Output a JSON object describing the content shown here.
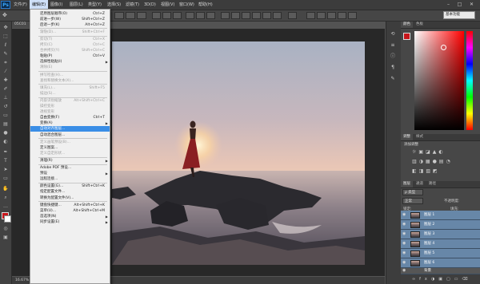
{
  "app": {
    "logo": "Ps"
  },
  "menubar": {
    "items": [
      "文件(F)",
      "编辑(E)",
      "图像(I)",
      "图层(L)",
      "类型(Y)",
      "选择(S)",
      "滤镜(T)",
      "3D(D)",
      "视图(V)",
      "窗口(W)",
      "帮助(H)"
    ],
    "active_index": 1
  },
  "options": {
    "workspace": "基本功能"
  },
  "document": {
    "tab": "05C01",
    "zoom": "16.67%"
  },
  "edit_menu": {
    "items": [
      {
        "label": "还原图层顺序(O)",
        "shortcut": "Ctrl+Z",
        "disabled": false
      },
      {
        "label": "前进一步(W)",
        "shortcut": "Shift+Ctrl+Z",
        "disabled": false
      },
      {
        "label": "后退一步(K)",
        "shortcut": "Alt+Ctrl+Z",
        "disabled": false
      },
      {
        "sep": true
      },
      {
        "label": "渐隐(D)...",
        "shortcut": "Shift+Ctrl+F",
        "disabled": true
      },
      {
        "sep": true
      },
      {
        "label": "剪切(T)",
        "shortcut": "Ctrl+X",
        "disabled": true
      },
      {
        "label": "拷贝(C)",
        "shortcut": "Ctrl+C",
        "disabled": true
      },
      {
        "label": "合并拷贝(Y)",
        "shortcut": "Shift+Ctrl+C",
        "disabled": true
      },
      {
        "label": "粘贴(P)",
        "shortcut": "Ctrl+V",
        "disabled": false
      },
      {
        "label": "选择性粘贴(I)",
        "shortcut": "",
        "disabled": false,
        "submenu": true
      },
      {
        "label": "清除(E)",
        "shortcut": "",
        "disabled": true
      },
      {
        "sep": true
      },
      {
        "label": "拼写检查(H)...",
        "shortcut": "",
        "disabled": true
      },
      {
        "label": "查找和替换文本(X)...",
        "shortcut": "",
        "disabled": true
      },
      {
        "sep": true
      },
      {
        "label": "填充(L)...",
        "shortcut": "Shift+F5",
        "disabled": true
      },
      {
        "label": "描边(S)...",
        "shortcut": "",
        "disabled": true
      },
      {
        "sep": true
      },
      {
        "label": "内容识别缩放",
        "shortcut": "Alt+Shift+Ctrl+C",
        "disabled": true
      },
      {
        "label": "操控变形",
        "shortcut": "",
        "disabled": true
      },
      {
        "label": "透视变形",
        "shortcut": "",
        "disabled": true
      },
      {
        "label": "自由变换(F)",
        "shortcut": "Ctrl+T",
        "disabled": false
      },
      {
        "label": "变换(A)",
        "shortcut": "",
        "disabled": false,
        "submenu": true
      },
      {
        "label": "自动对齐图层...",
        "shortcut": "",
        "disabled": false,
        "highlight": true
      },
      {
        "label": "自动混合图层...",
        "shortcut": "",
        "disabled": false
      },
      {
        "sep": true
      },
      {
        "label": "定义画笔预设(B)...",
        "shortcut": "",
        "disabled": true
      },
      {
        "label": "定义图案...",
        "shortcut": "",
        "disabled": false
      },
      {
        "label": "定义自定形状...",
        "shortcut": "",
        "disabled": true
      },
      {
        "sep": true
      },
      {
        "label": "清理(R)",
        "shortcut": "",
        "disabled": false,
        "submenu": true
      },
      {
        "sep": true
      },
      {
        "label": "Adobe PDF 预设...",
        "shortcut": "",
        "disabled": false
      },
      {
        "label": "预设",
        "shortcut": "",
        "disabled": false,
        "submenu": true
      },
      {
        "label": "远程连接...",
        "shortcut": "",
        "disabled": false
      },
      {
        "sep": true
      },
      {
        "label": "颜色设置(G)...",
        "shortcut": "Shift+Ctrl+K",
        "disabled": false
      },
      {
        "label": "指定配置文件...",
        "shortcut": "",
        "disabled": false
      },
      {
        "label": "转换为配置文件(V)...",
        "shortcut": "",
        "disabled": false
      },
      {
        "sep": true
      },
      {
        "label": "键盘快捷键...",
        "shortcut": "Alt+Shift+Ctrl+K",
        "disabled": false
      },
      {
        "label": "菜单(U)...",
        "shortcut": "Alt+Shift+Ctrl+M",
        "disabled": false
      },
      {
        "label": "首选项(N)",
        "shortcut": "",
        "disabled": false,
        "submenu": true
      },
      {
        "label": "同步设置(E)",
        "shortcut": "",
        "disabled": false,
        "submenu": true
      }
    ]
  },
  "panels": {
    "color_tabs": [
      "颜色",
      "色板"
    ],
    "adjust_tabs": [
      "调整",
      "样式"
    ],
    "adjust_title": "添加调整",
    "layers_tabs": [
      "图层",
      "通道",
      "路径"
    ],
    "layer_kind": "ρ 类型",
    "blend_mode": "正常",
    "opacity_label": "不透明度:",
    "lock_label": "锁定:",
    "fill_label": "填充:",
    "layers": [
      "图层 1",
      "图层 2",
      "图层 3",
      "图层 4",
      "图层 5",
      "图层 6",
      "背景"
    ]
  },
  "colors": {
    "accent": "#3a8ee6",
    "foreground": "#c7161b",
    "background": "#ffffff"
  }
}
